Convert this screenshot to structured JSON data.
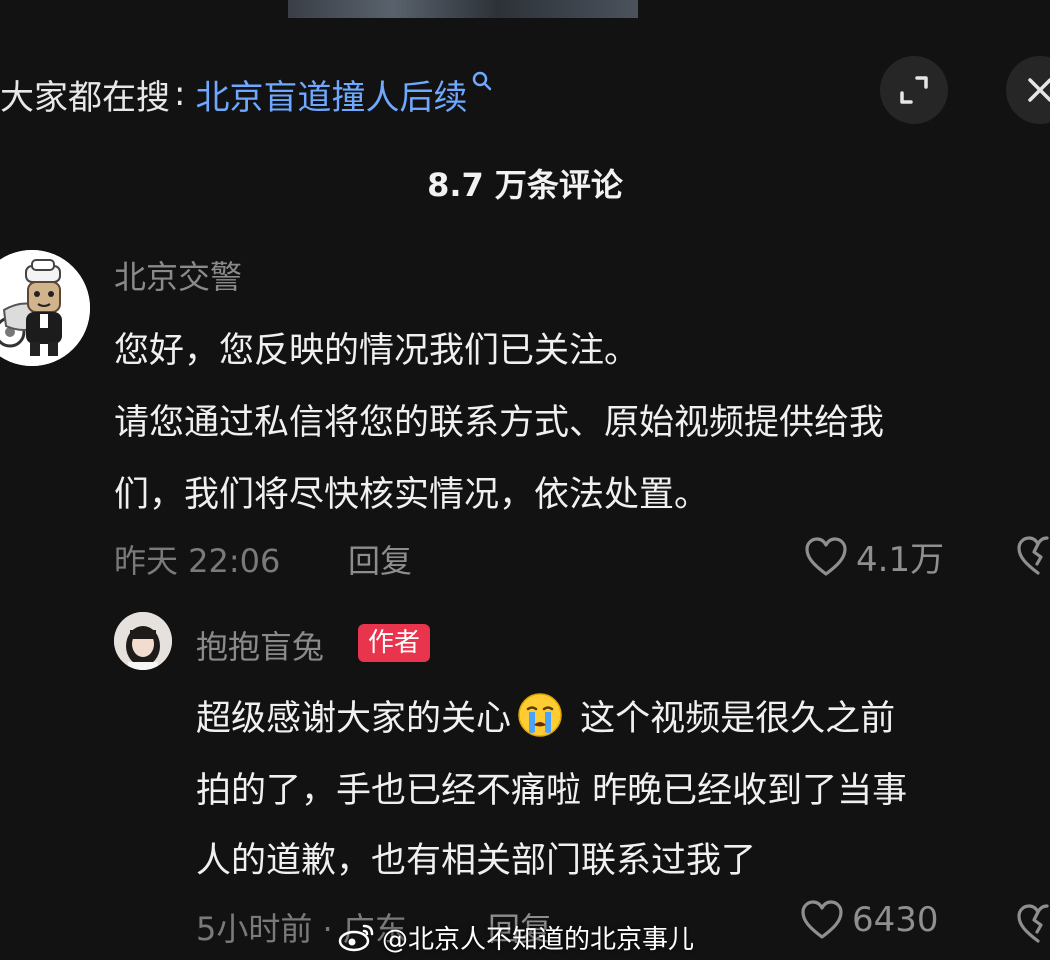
{
  "header": {
    "search_prefix": "大家都在搜",
    "search_separator": ":",
    "search_term": "北京盲道撞人后续",
    "expand_icon": "expand-icon",
    "close_icon": "close-icon"
  },
  "comment_count": "8.7 万条评论",
  "comments": [
    {
      "username": "北京交警",
      "lines": [
        "您好，您反映的情况我们已关注。",
        "请您通过私信将您的联系方式、原始视频提供给我",
        "们，我们将尽快核实情况，依法处置。"
      ],
      "time": "昨天 22:06",
      "reply_label": "回复",
      "likes": "4.1万"
    },
    {
      "username": "抱抱盲兔",
      "badge": "作者",
      "lines_first_a": "超级感谢大家的关心",
      "lines_first_b": " 这个视频是很久之前",
      "lines": [
        "拍的了，手也已经不痛啦 昨晚已经收到了当事",
        "人的道歉，也有相关部门联系过我了"
      ],
      "time": "5小时前 · 广东",
      "reply_label": "回复",
      "likes": "6430"
    }
  ],
  "watermark": "@北京人不知道的北京事儿",
  "colors": {
    "background": "#121212",
    "link_blue": "#6ea8ff",
    "badge_red": "#e8354d",
    "muted_text": "#8a8a8a"
  }
}
